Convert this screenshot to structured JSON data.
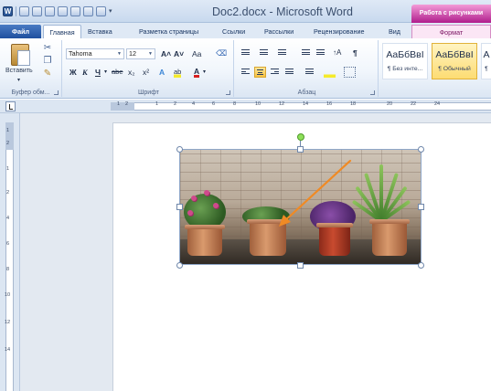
{
  "title_bar": {
    "document_title": "Doc2.docx - Microsoft Word",
    "contextual_tools_label": "Работа с рисунками",
    "qat_icons": [
      "word-app-icon",
      "undo-icon",
      "redo-icon",
      "new-doc-icon",
      "save-icon",
      "print-preview-icon",
      "open-icon",
      "spelling-icon",
      "dropdown-icon"
    ]
  },
  "tabs": {
    "file": "Файл",
    "home": "Главная",
    "insert": "Вставка",
    "page_layout": "Разметка страницы",
    "references": "Ссылки",
    "mailings": "Рассылки",
    "review": "Рецензирование",
    "view": "Вид",
    "format": "Формат"
  },
  "ribbon": {
    "clipboard": {
      "paste_label": "Вставить",
      "group_label": "Буфер обм...",
      "icons": [
        "paste-icon",
        "cut-icon",
        "copy-icon",
        "format-painter-icon"
      ]
    },
    "font": {
      "font_name": "Tahoma",
      "font_size": "12",
      "grow": "A˄",
      "shrink": "A˅",
      "case": "Aa",
      "bold": "Ж",
      "italic": "К",
      "underline": "Ч",
      "strike": "abe",
      "subscript": "x₂",
      "superscript": "x²",
      "effects": "A",
      "highlight": "ab",
      "font_color": "A",
      "group_label": "Шрифт"
    },
    "paragraph": {
      "group_label": "Абзац",
      "sort": "↑A",
      "pilcrow": "¶"
    },
    "styles": {
      "sample_text": "АаБбВвI",
      "items": [
        "¶ Без инте...",
        "¶ Обычный",
        "¶"
      ]
    }
  },
  "ruler": {
    "h_numbers": [
      "1",
      "2",
      "1",
      "2",
      "4",
      "6",
      "8",
      "10",
      "12",
      "14",
      "16",
      "18",
      "20",
      "22",
      "24"
    ],
    "v_numbers": [
      "1",
      "2",
      "1",
      "2",
      "4",
      "6",
      "8",
      "10",
      "12",
      "14"
    ]
  },
  "image": {
    "description_icon": "potted-plants-photo",
    "arrow_color": "#f08a24",
    "selection_handle_color": "#6f87aa",
    "rotate_handle_color": "#8ee05a"
  },
  "colors": {
    "file_tab": "#2b5797",
    "contextual_tab": "#b01d8c",
    "ribbon_bg": "#f1f6fc",
    "workspace_bg": "#e3e9f1"
  }
}
